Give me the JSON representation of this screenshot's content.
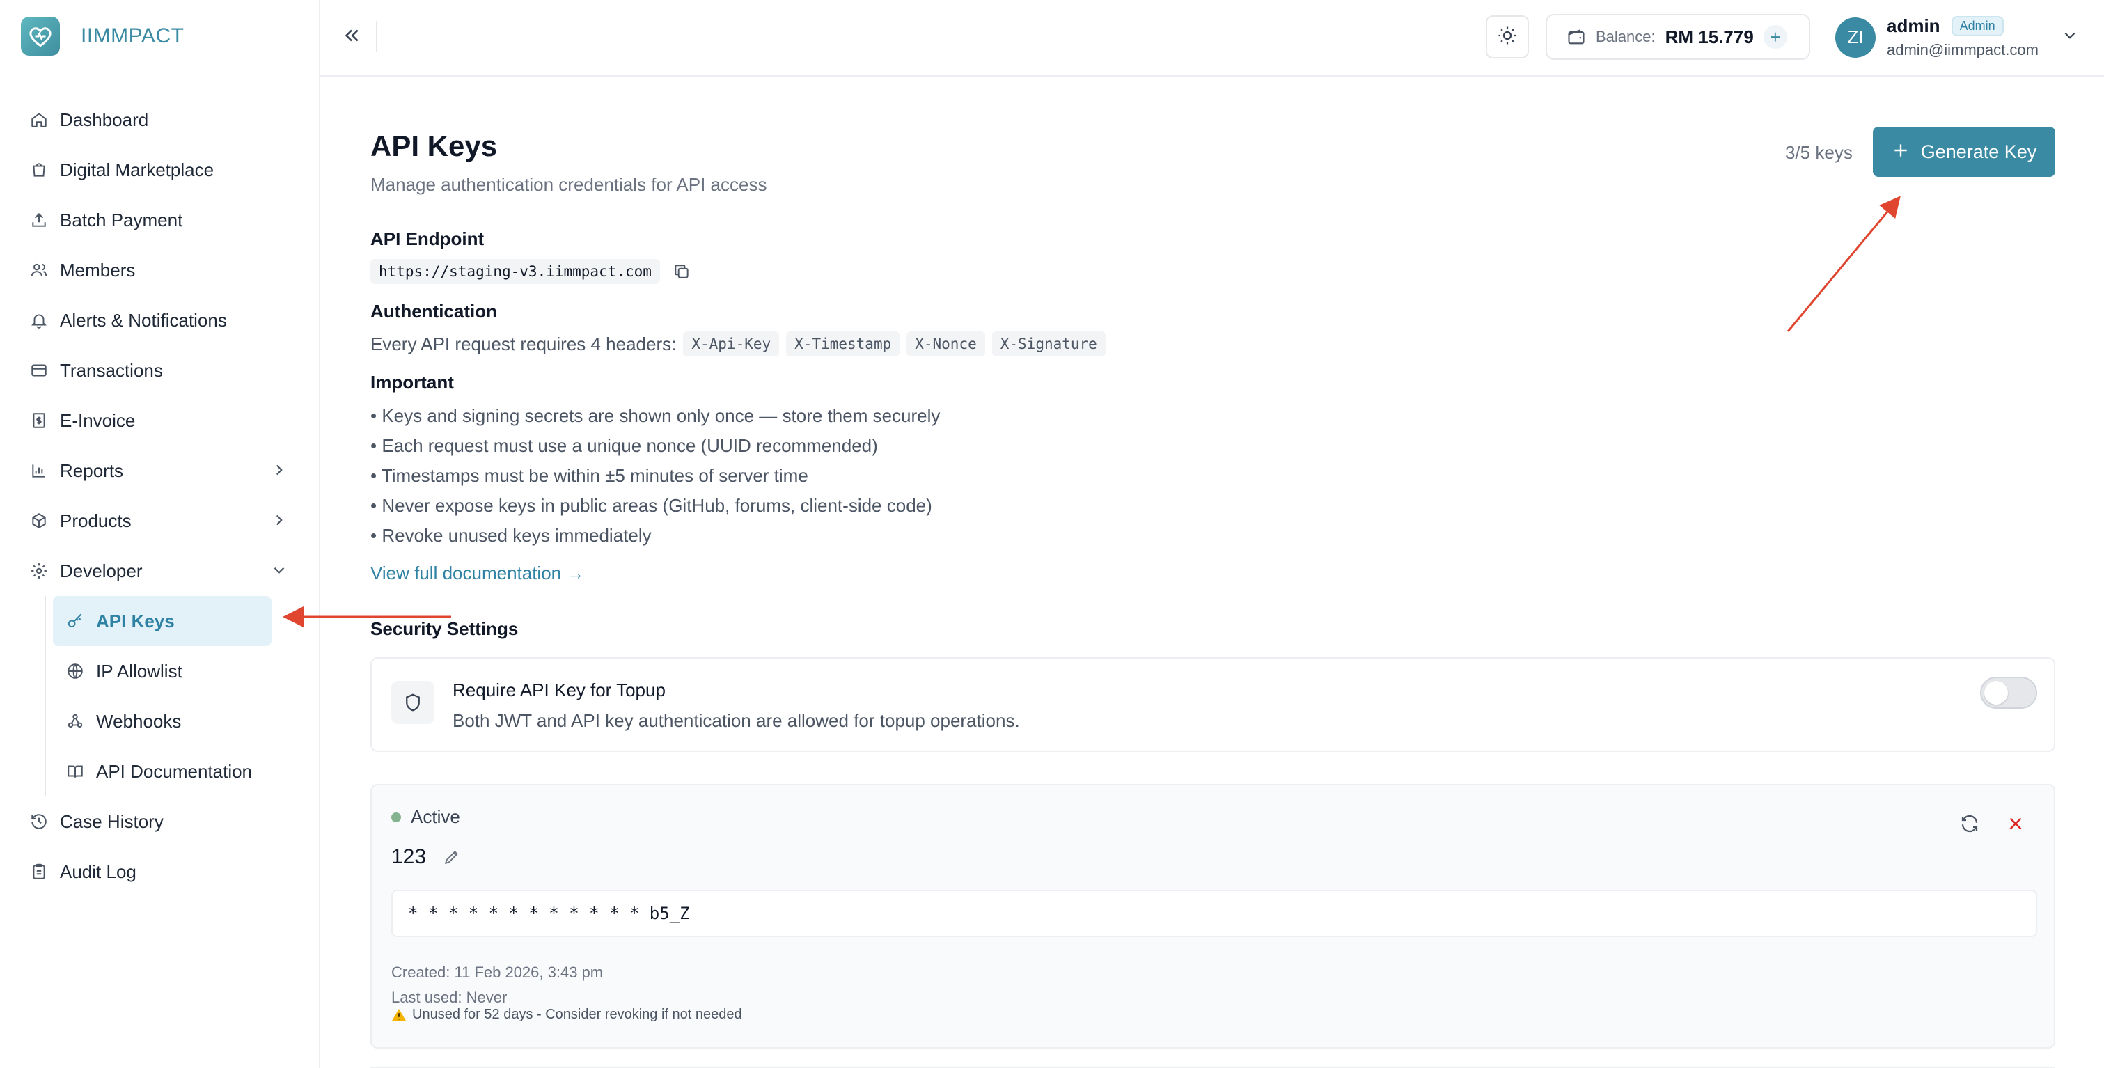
{
  "brand": {
    "name": "IIMMPACT"
  },
  "sidebar": {
    "items": [
      {
        "label": "Dashboard",
        "icon": "home-icon"
      },
      {
        "label": "Digital Marketplace",
        "icon": "shopping-bag-icon"
      },
      {
        "label": "Batch Payment",
        "icon": "upload-icon"
      },
      {
        "label": "Members",
        "icon": "users-icon"
      },
      {
        "label": "Alerts & Notifications",
        "icon": "bell-icon"
      },
      {
        "label": "Transactions",
        "icon": "credit-card-icon"
      },
      {
        "label": "E-Invoice",
        "icon": "receipt-icon"
      },
      {
        "label": "Reports",
        "icon": "bar-chart-icon"
      },
      {
        "label": "Products",
        "icon": "package-icon"
      },
      {
        "label": "Developer",
        "icon": "gear-icon"
      }
    ],
    "developer_sub": [
      {
        "label": "API Keys",
        "icon": "key-icon",
        "active": true
      },
      {
        "label": "IP Allowlist",
        "icon": "globe-icon"
      },
      {
        "label": "Webhooks",
        "icon": "webhook-icon"
      },
      {
        "label": "API Documentation",
        "icon": "book-icon"
      }
    ],
    "bottom": [
      {
        "label": "Case History",
        "icon": "history-icon"
      },
      {
        "label": "Audit Log",
        "icon": "clipboard-icon"
      }
    ]
  },
  "header": {
    "balance_label": "Balance:",
    "balance_value": "RM 15.779",
    "balance_add": "+",
    "user": {
      "initials": "ZI",
      "name": "admin",
      "role": "Admin",
      "email": "admin@iimmpact.com"
    }
  },
  "page": {
    "title": "API Keys",
    "subtitle": "Manage authentication credentials for API access",
    "key_count": "3/5 keys",
    "generate_label": "Generate Key",
    "endpoint_heading": "API Endpoint",
    "endpoint_url": "https://staging-v3.iimmpact.com",
    "auth_heading": "Authentication",
    "auth_text": "Every API request requires 4 headers:",
    "auth_headers": [
      "X-Api-Key",
      "X-Timestamp",
      "X-Nonce",
      "X-Signature"
    ],
    "important_heading": "Important",
    "important_items": [
      "• Keys and signing secrets are shown only once — store them securely",
      "• Each request must use a unique nonce (UUID recommended)",
      "• Timestamps must be within ±5 minutes of server time",
      "• Never expose keys in public areas (GitHub, forums, client-side code)",
      "• Revoke unused keys immediately"
    ],
    "doc_link": "View full documentation →",
    "security_heading": "Security Settings",
    "security_card": {
      "title": "Require API Key for Topup",
      "description": "Both JWT and API key authentication are allowed for topup operations.",
      "enabled": false
    },
    "key_card": {
      "status": "Active",
      "name": "123",
      "masked_key": "* * * * * * * * * * * * b5_Z",
      "created": "Created: 11 Feb 2026, 3:43 pm",
      "last_used": "Last used: Never",
      "warning": "Unused for 52 days - Consider revoking if not needed"
    }
  },
  "colors": {
    "accent": "#3b8aa3",
    "active_bg": "#e3f2f8",
    "status_active": "#86b38f",
    "danger": "#dc2626",
    "annotation": "#e0452f"
  }
}
